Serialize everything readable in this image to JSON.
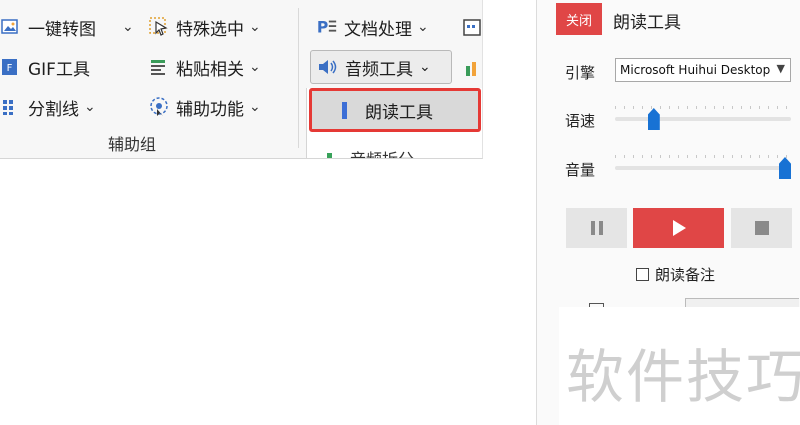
{
  "ribbon": {
    "col1": [
      {
        "label": "一键转图",
        "icon": "image-convert-icon"
      },
      {
        "label": "GIF工具",
        "icon": "gif-icon"
      },
      {
        "label": "分割线",
        "icon": "grid-icon"
      }
    ],
    "col2": [
      {
        "label": "特殊选中",
        "icon": "cursor-select-icon"
      },
      {
        "label": "粘贴相关",
        "icon": "paste-icon"
      },
      {
        "label": "辅助功能",
        "icon": "accessibility-icon"
      }
    ],
    "group_label": "辅助组",
    "doc_processing": "文档处理",
    "audio_tools": "音频工具",
    "dropdown_items": [
      "朗读工具",
      "音频拆分"
    ]
  },
  "panel": {
    "close_label": "关闭",
    "title": "朗读工具",
    "engine_label": "引擎",
    "engine_value": "Microsoft Huihui Desktop",
    "speed_label": "语速",
    "speed_value": 0.2,
    "volume_label": "音量",
    "volume_value": 1.0,
    "read_notes_label": "朗读备注",
    "accent_color": "#e04646"
  },
  "watermark": "软件技巧"
}
